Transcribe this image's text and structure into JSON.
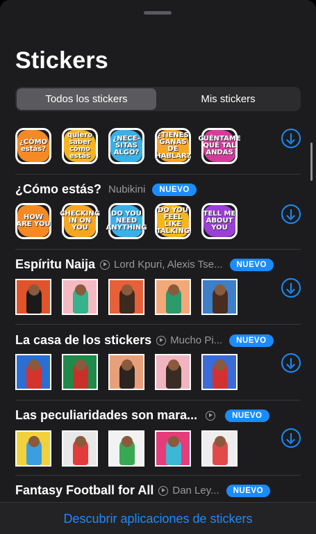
{
  "header": {
    "title": "Stickers"
  },
  "tabs": [
    {
      "label": "Todos los stickers",
      "selected": true
    },
    {
      "label": "Mis stickers",
      "selected": false
    }
  ],
  "featured": {
    "stickers": [
      {
        "text": "¿CÓMO estás?",
        "color": "#f58a24"
      },
      {
        "text": "quiero saber cómo estás",
        "color": "#f6b51e"
      },
      {
        "text": "¿NECE- SITAS ALGO?",
        "color": "#3ab0e8"
      },
      {
        "text": "¿TIENES GANAS DE HABLAR?",
        "color": "#f6a623"
      },
      {
        "text": "CUÉNTAME QUÉ TAL ANDAS",
        "color": "#d43c9c"
      }
    ]
  },
  "packs": [
    {
      "name": "¿Cómo estás?",
      "author": "Nubikini",
      "badge": "NUEVO",
      "has_play": false,
      "stickers": [
        {
          "text": "HOW ARE YOU",
          "color": "#f58a24"
        },
        {
          "text": "CHECKING IN ON YOU",
          "color": "#f6a623"
        },
        {
          "text": "DO YOU NEED ANYTHING",
          "color": "#3ab0e8"
        },
        {
          "text": "DO YOU FEEL LIKE TALKING",
          "color": "#f6b51e"
        },
        {
          "text": "TELL ME ABOUT YOU",
          "color": "#9b3fd6"
        }
      ]
    },
    {
      "name": "Espíritu Naija",
      "author": "Lord Kpuri, Alexis Tse...",
      "badge": "NUEVO",
      "has_play": true,
      "stickers": [
        {
          "bg": "#e0532b",
          "fg": "#1a1a1a"
        },
        {
          "bg": "#f5b9c4",
          "fg": "#36b38a"
        },
        {
          "bg": "#e6603a",
          "fg": "#3b2a1e"
        },
        {
          "bg": "#f2a878",
          "fg": "#2c9a6a"
        },
        {
          "bg": "#3d7fc9",
          "fg": "#4a2d1f"
        }
      ]
    },
    {
      "name": "La casa de los stickers",
      "author": "Mucho Pi...",
      "badge": "NUEVO",
      "has_play": true,
      "stickers": [
        {
          "bg": "#2a6fd1",
          "fg": "#d6332c"
        },
        {
          "bg": "#1f8a4a",
          "fg": "#c8312b"
        },
        {
          "bg": "#e8a07a",
          "fg": "#2b2420"
        },
        {
          "bg": "#f0b5c0",
          "fg": "#3a2c24"
        },
        {
          "bg": "#3a6bd6",
          "fg": "#d33131"
        }
      ]
    },
    {
      "name": "Las peculiaridades son mara...",
      "author": "",
      "badge": "NUEVO",
      "has_play": true,
      "stickers": [
        {
          "bg": "#f2d23c",
          "fg": "#3a9ee0"
        },
        {
          "bg": "#e8e8e8",
          "fg": "#e23b3b"
        },
        {
          "bg": "#f2f2f2",
          "fg": "#38a852"
        },
        {
          "bg": "#e43d7a",
          "fg": "#3cb7d6"
        },
        {
          "bg": "#eeeeee",
          "fg": "#e24a4a"
        }
      ]
    },
    {
      "name": "Fantasy Football for All",
      "author": "Dan Ley...",
      "badge": "NUEVO",
      "has_play": true,
      "stickers": []
    }
  ],
  "footer": {
    "link": "Descubrir aplicaciones de stickers"
  }
}
